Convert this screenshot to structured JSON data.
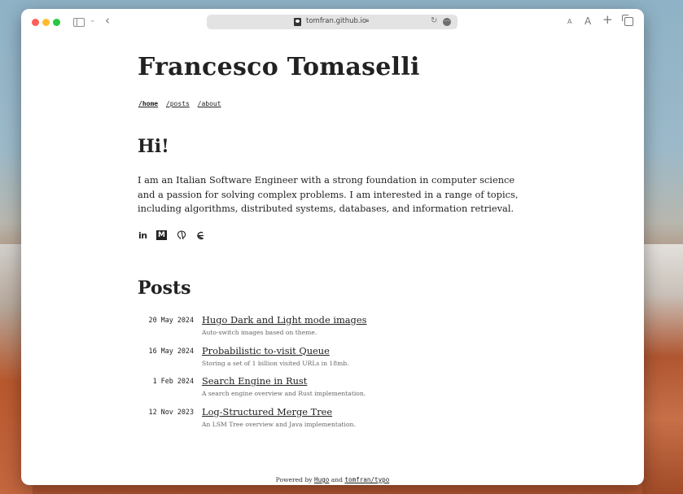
{
  "browser": {
    "url": "tomfran.github.io",
    "font_small_label": "A",
    "font_large_label": "A",
    "new_tab_label": "+",
    "back_label": "‹",
    "reload_label": "↻",
    "more_label": "•••"
  },
  "site": {
    "title": "Francesco Tomaselli",
    "nav": [
      {
        "label": "/home",
        "active": true
      },
      {
        "label": "/posts",
        "active": false
      },
      {
        "label": "/about",
        "active": false
      }
    ]
  },
  "intro": {
    "heading": "Hi!",
    "bio": "I am an Italian Software Engineer with a strong foundation in computer science and a passion for solving complex problems. I am interested in a range of topics, including algorithms, distributed systems, databases, and information retrieval.",
    "socials": [
      {
        "icon": "linkedin-icon",
        "glyph": "in"
      },
      {
        "icon": "medium-icon",
        "glyph": "M"
      },
      {
        "icon": "github-icon",
        "glyph": "⌘"
      },
      {
        "icon": "goodreads-icon",
        "glyph": "ɡ"
      }
    ]
  },
  "posts": {
    "heading": "Posts",
    "items": [
      {
        "date": "20 May 2024",
        "title": "Hugo Dark and Light mode images",
        "description": "Auto-switch images based on theme."
      },
      {
        "date": "16 May 2024",
        "title": "Probabilistic to-visit Queue",
        "description": "Storing a set of 1 billion visited URLs in 18mb."
      },
      {
        "date": "1 Feb 2024",
        "title": "Search Engine in Rust",
        "description": "A search engine overview and Rust implementation."
      },
      {
        "date": "12 Nov 2023",
        "title": "Log-Structured Merge Tree",
        "description": "An LSM Tree overview and Java implementation."
      }
    ]
  },
  "footer": {
    "prefix": "Powered by",
    "hugo_label": "Hugo",
    "and_label": "and",
    "theme_label": "tomfran/typo"
  }
}
